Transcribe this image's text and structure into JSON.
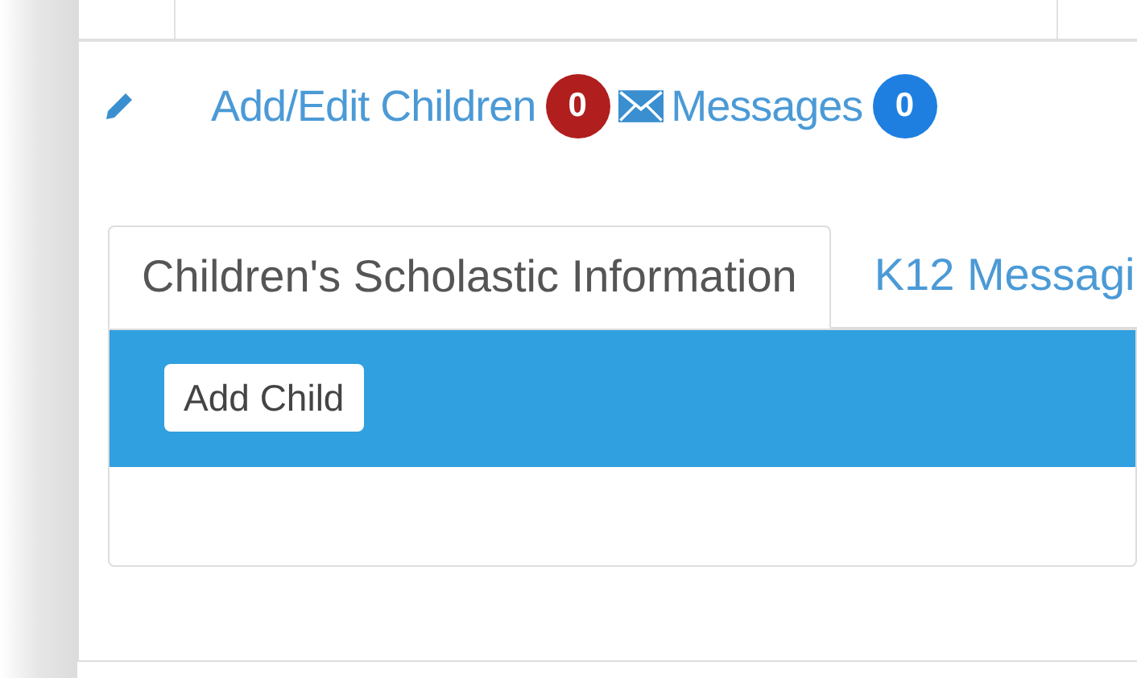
{
  "links": [
    {
      "kind": "edit",
      "label": "Add/Edit Children",
      "count": "0",
      "color": "#b01e1e"
    },
    {
      "kind": "mail",
      "label": "Messages",
      "count": "0",
      "color": "#1e7fe0"
    }
  ],
  "tabs": [
    {
      "label": "Children's Scholastic Information",
      "selected": true
    },
    {
      "label": "K12 Messagi",
      "selected": false
    }
  ],
  "toolbar": {
    "button": "Add Child"
  }
}
